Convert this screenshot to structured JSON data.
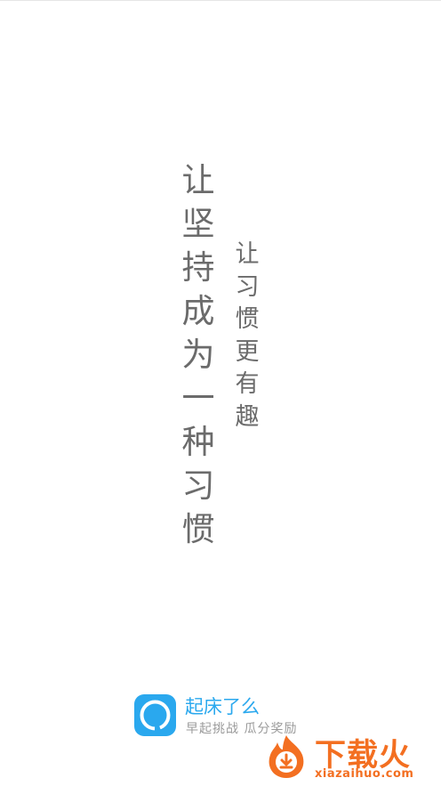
{
  "splash": {
    "main_tagline": [
      "让",
      "坚",
      "持",
      "成",
      "为",
      "一",
      "种",
      "习",
      "惯"
    ],
    "sub_tagline": [
      "让",
      "习",
      "惯",
      "更",
      "有",
      "趣"
    ]
  },
  "brand": {
    "app_name": "起床了么",
    "slogan": "早起挑战  瓜分奖励",
    "logo_icon": "alarm-ring-icon",
    "color": "#2aa8ee"
  },
  "watermark": {
    "text": "下载火",
    "url": "xiazaihuo.com",
    "icon": "download-flame-icon",
    "color": "#f36f21"
  }
}
